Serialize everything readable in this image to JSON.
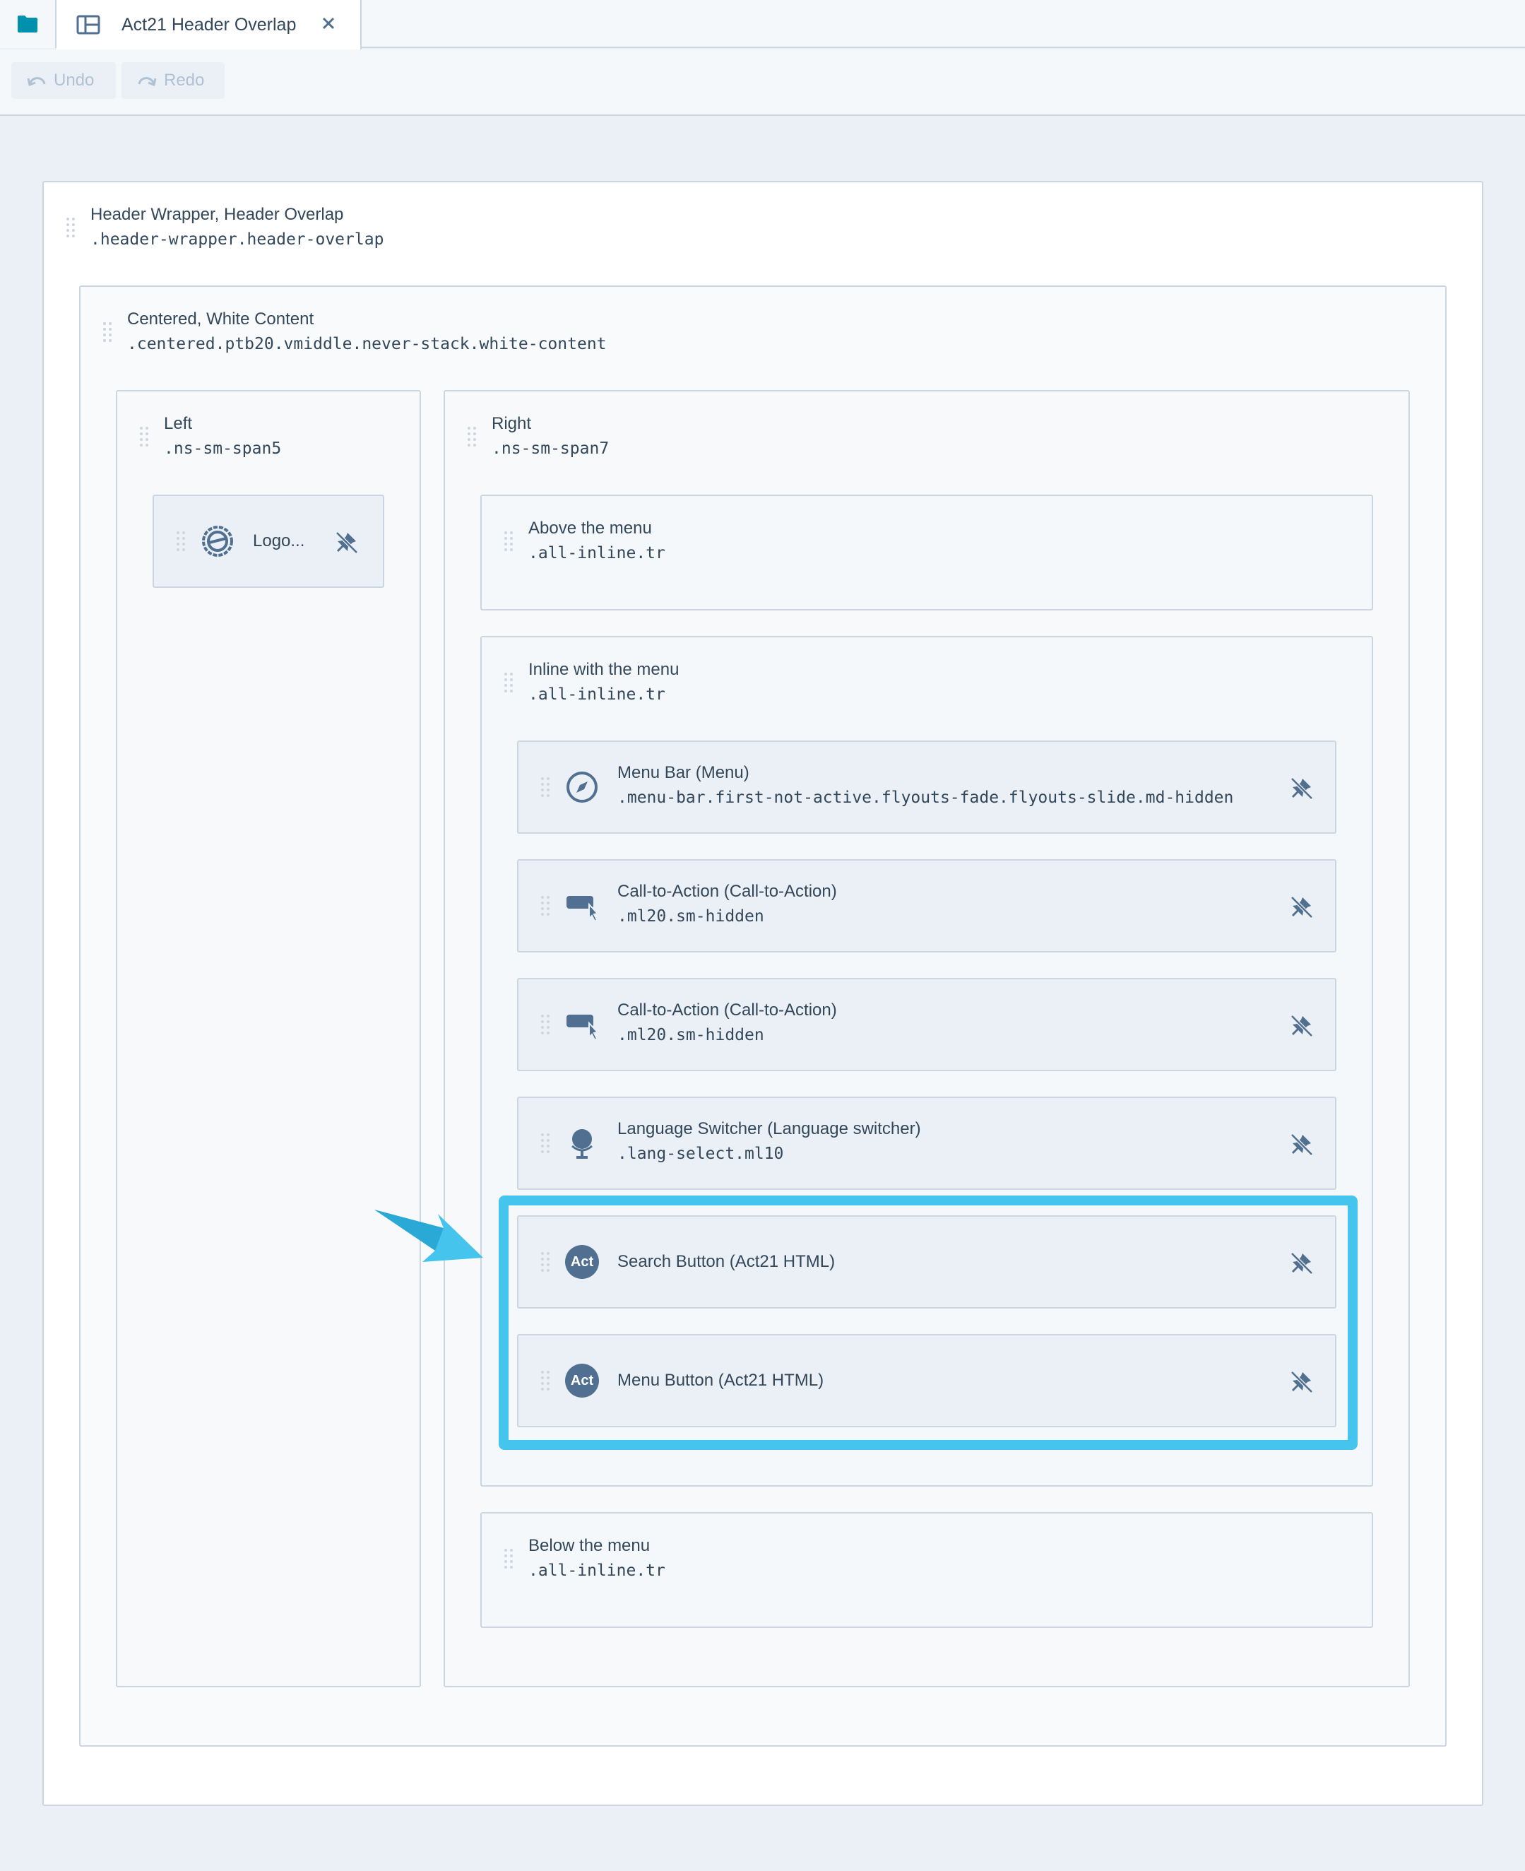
{
  "tabs": {
    "folder_icon": "folder-icon",
    "layout_icon": "layout-icon",
    "active_title": "Act21 Header Overlap",
    "close_icon": "close-icon"
  },
  "toolbar": {
    "undo_label": "Undo",
    "redo_label": "Redo"
  },
  "layout": {
    "wrapper": {
      "title": "Header Wrapper, Header Overlap",
      "css": ".header-wrapper.header-overlap"
    },
    "centered": {
      "title": "Centered, White Content",
      "css": ".centered.ptb20.vmiddle.never-stack.white-content"
    },
    "left": {
      "title": "Left",
      "css": ".ns-sm-span5",
      "logo_label": "Logo..."
    },
    "right": {
      "title": "Right",
      "css": ".ns-sm-span7",
      "above": {
        "title": "Above the menu",
        "css": ".all-inline.tr"
      },
      "inline": {
        "title": "Inline with the menu",
        "css": ".all-inline.tr",
        "modules": [
          {
            "title": "Menu Bar (Menu)",
            "css": ".menu-bar.first-not-active.flyouts-fade.flyouts-slide.md-hidden",
            "icon": "compass-icon"
          },
          {
            "title": "Call-to-Action (Call-to-Action)",
            "css": ".ml20.sm-hidden",
            "icon": "cta-icon"
          },
          {
            "title": "Call-to-Action (Call-to-Action)",
            "css": ".ml20.sm-hidden",
            "icon": "cta-icon"
          },
          {
            "title": "Language Switcher (Language switcher)",
            "css": ".lang-select.ml10",
            "icon": "globe-icon"
          },
          {
            "title": "Search Button (Act21 HTML)",
            "icon": "act21-icon",
            "badge": "Act"
          },
          {
            "title": "Menu Button (Act21 HTML)",
            "icon": "act21-icon",
            "badge": "Act"
          }
        ]
      },
      "below": {
        "title": "Below the menu",
        "css": ".all-inline.tr"
      }
    }
  },
  "annotation": {
    "highlight_color": "#45c5ee",
    "arrow_color": "#45c5ee"
  }
}
